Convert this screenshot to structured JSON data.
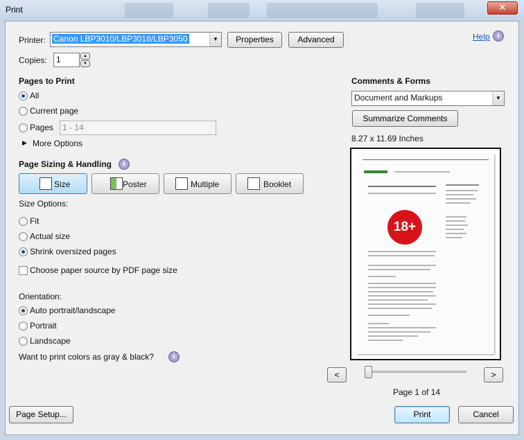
{
  "window": {
    "title": "Print",
    "close_glyph": "✕"
  },
  "printer": {
    "label": "Printer:",
    "value": "Canon LBP3010/LBP3018/LBP3050",
    "properties": "Properties",
    "advanced": "Advanced"
  },
  "help": {
    "label": "Help"
  },
  "copies": {
    "label": "Copies:",
    "value": "1"
  },
  "pages_to_print": {
    "heading": "Pages to Print",
    "all": "All",
    "current": "Current page",
    "pages": "Pages",
    "pages_placeholder": "1 - 14",
    "more": "More Options"
  },
  "sizing": {
    "heading": "Page Sizing & Handling",
    "size": "Size",
    "poster": "Poster",
    "multiple": "Multiple",
    "booklet": "Booklet",
    "options_label": "Size Options:",
    "fit": "Fit",
    "actual": "Actual size",
    "shrink": "Shrink oversized pages",
    "choose_source": "Choose paper source by PDF page size"
  },
  "orientation": {
    "label": "Orientation:",
    "auto": "Auto portrait/landscape",
    "portrait": "Portrait",
    "landscape": "Landscape"
  },
  "gray_question": "Want to print colors as gray & black?",
  "comments": {
    "heading": "Comments & Forms",
    "value": "Document and Markups",
    "summarize": "Summarize Comments"
  },
  "preview": {
    "paper_size": "8.27 x 11.69 Inches",
    "page_label": "Page 1 of 14",
    "badge": "18+",
    "prev": "<",
    "next": ">"
  },
  "footer": {
    "page_setup": "Page Setup...",
    "print": "Print",
    "cancel": "Cancel"
  },
  "colors": {
    "accent": "#3c7fb1",
    "selection": "#3399ff",
    "badge_red": "#d7141a"
  }
}
